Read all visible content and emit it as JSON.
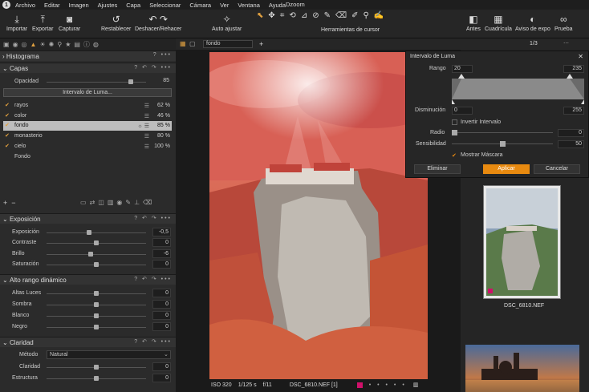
{
  "menubar": {
    "items": [
      "Archivo",
      "Editar",
      "Imagen",
      "Ajustes",
      "Capa",
      "Seleccionar",
      "Cámara",
      "Ver",
      "Ventana",
      "Ayuda"
    ],
    "app_title": "Dzoom"
  },
  "toolbar": {
    "import": "Importar",
    "export": "Exportar",
    "capture": "Capturar",
    "reset": "Restablecer",
    "undo": "Deshacer/Rehacer",
    "auto": "Auto ajustar",
    "cursor_tools": "Herramientas de cursor",
    "before": "Antes",
    "grid": "Cuadrícula",
    "exposure_warning": "Aviso de expo",
    "proof": "Prueba"
  },
  "left": {
    "histogram": "Histograma",
    "layers": {
      "title": "Capas",
      "opacity_label": "Opacidad",
      "opacity_value": "85",
      "opacity_level": 0.85,
      "luma_button": "Intervalo de Luma...",
      "items": [
        {
          "name": "rayos",
          "opacity": "62 %"
        },
        {
          "name": "color",
          "opacity": "46 %"
        },
        {
          "name": "fondo",
          "opacity": "85 %"
        },
        {
          "name": "monasterio",
          "opacity": "80 %"
        },
        {
          "name": "cielo",
          "opacity": "100 %"
        },
        {
          "name": "Fondo",
          "opacity": ""
        }
      ]
    },
    "exposure": {
      "title": "Exposición",
      "rows": [
        {
          "label": "Exposición",
          "value": "-0,5"
        },
        {
          "label": "Contraste",
          "value": "0"
        },
        {
          "label": "Brillo",
          "value": "-6"
        },
        {
          "label": "Saturación",
          "value": "0"
        }
      ]
    },
    "hdr": {
      "title": "Alto rango dinámico",
      "rows": [
        {
          "label": "Altas Luces",
          "value": "0"
        },
        {
          "label": "Sombra",
          "value": "0"
        },
        {
          "label": "Blanco",
          "value": "0"
        },
        {
          "label": "Negro",
          "value": "0"
        }
      ]
    },
    "clarity": {
      "title": "Claridad",
      "method_label": "Método",
      "method_value": "Natural",
      "rows": [
        {
          "label": "Claridad",
          "value": "0"
        },
        {
          "label": "Estructura",
          "value": "0"
        }
      ]
    }
  },
  "viewer": {
    "layer_select": "fondo",
    "iso": "ISO 320",
    "shutter": "1/125 s",
    "aperture": "f/11",
    "filename": "DSC_6810.NEF [1]"
  },
  "right": {
    "count": "1/3",
    "thumb1_name": "DSC_6810.NEF"
  },
  "luma": {
    "title": "Intervalo de Luma",
    "range_label": "Rango",
    "range_min": "20",
    "range_max": "235",
    "falloff_label": "Disminución",
    "falloff_min": "0",
    "falloff_max": "255",
    "invert_label": "Invertir Intervalo",
    "radius_label": "Radio",
    "radius_value": "0",
    "sensitivity_label": "Sensibilidad",
    "sensitivity_value": "50",
    "show_mask_label": "Mostrar Máscara",
    "delete": "Eliminar",
    "apply": "Aplicar",
    "cancel": "Cancelar"
  },
  "colors": {
    "accent": "#e88a10",
    "selected_layer": "#bdbdbd",
    "photo_tint": "#d85a4a"
  }
}
